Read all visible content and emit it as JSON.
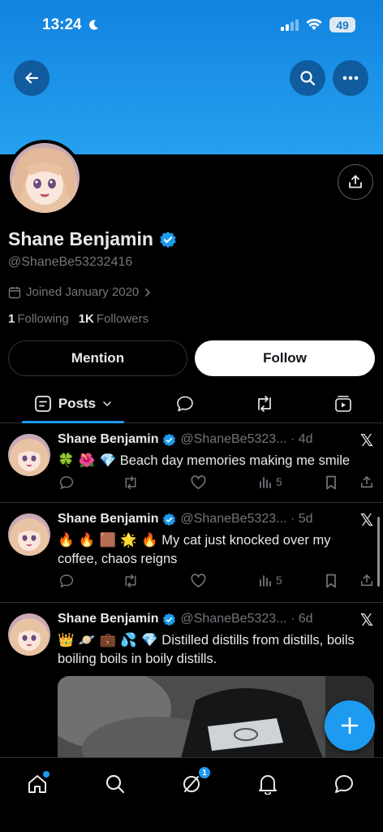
{
  "status_bar": {
    "time": "13:24",
    "battery": "49"
  },
  "profile": {
    "name": "Shane Benjamin",
    "handle": "@ShaneBe53232416",
    "joined": "Joined January 2020",
    "following_count": "1",
    "following_label": "Following",
    "followers_count": "1K",
    "followers_label": "Followers"
  },
  "buttons": {
    "mention": "Mention",
    "follow": "Follow"
  },
  "tabs": {
    "posts": "Posts"
  },
  "posts": [
    {
      "name": "Shane Benjamin",
      "meta": "@ShaneBe5323... · 4d",
      "emojis": "🍀 🌺 💎",
      "text": "Beach day memories making me smile",
      "views": "5"
    },
    {
      "name": "Shane Benjamin",
      "meta": "@ShaneBe5323... · 5d",
      "emojis": "🔥 🔥 🟫 🌟 🔥",
      "text": "My cat just knocked over my coffee, chaos reigns",
      "views": "5"
    },
    {
      "name": "Shane Benjamin",
      "meta": "@ShaneBe5323... · 6d",
      "emojis": "👑 🪐 💼 💦 💎",
      "text": "Distilled distills from distills, boils boiling boils in boily distills."
    }
  ],
  "x_logo": "𝕏",
  "colors": {
    "accent": "#1d9bf0",
    "banner": "#1d8fe6",
    "muted": "#71767b",
    "background": "#000000"
  },
  "bottom_nav": {
    "messages_badge": "1"
  }
}
